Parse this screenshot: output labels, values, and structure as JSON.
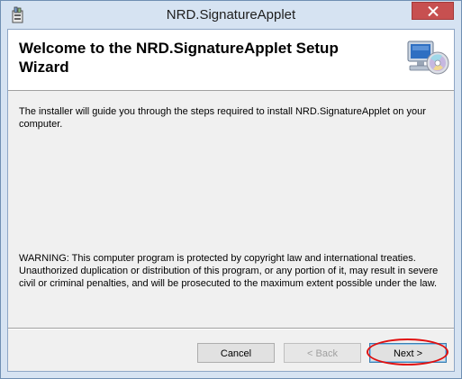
{
  "window": {
    "title": "NRD.SignatureApplet",
    "app_icon": "installer-package-icon",
    "close_icon": "close-icon"
  },
  "banner": {
    "heading": "Welcome to the NRD.SignatureApplet Setup Wizard",
    "icon": "computer-cd-icon"
  },
  "body": {
    "intro": "The installer will guide you through the steps required to install NRD.SignatureApplet on your computer.",
    "warning": "WARNING: This computer program is protected by copyright law and international treaties. Unauthorized duplication or distribution of this program, or any portion of it, may result in severe civil or criminal penalties, and will be prosecuted to the maximum extent possible under the law."
  },
  "buttons": {
    "cancel": "Cancel",
    "back": "< Back",
    "next": "Next >"
  },
  "colors": {
    "highlight": "#e01010",
    "close_button": "#c75050"
  }
}
